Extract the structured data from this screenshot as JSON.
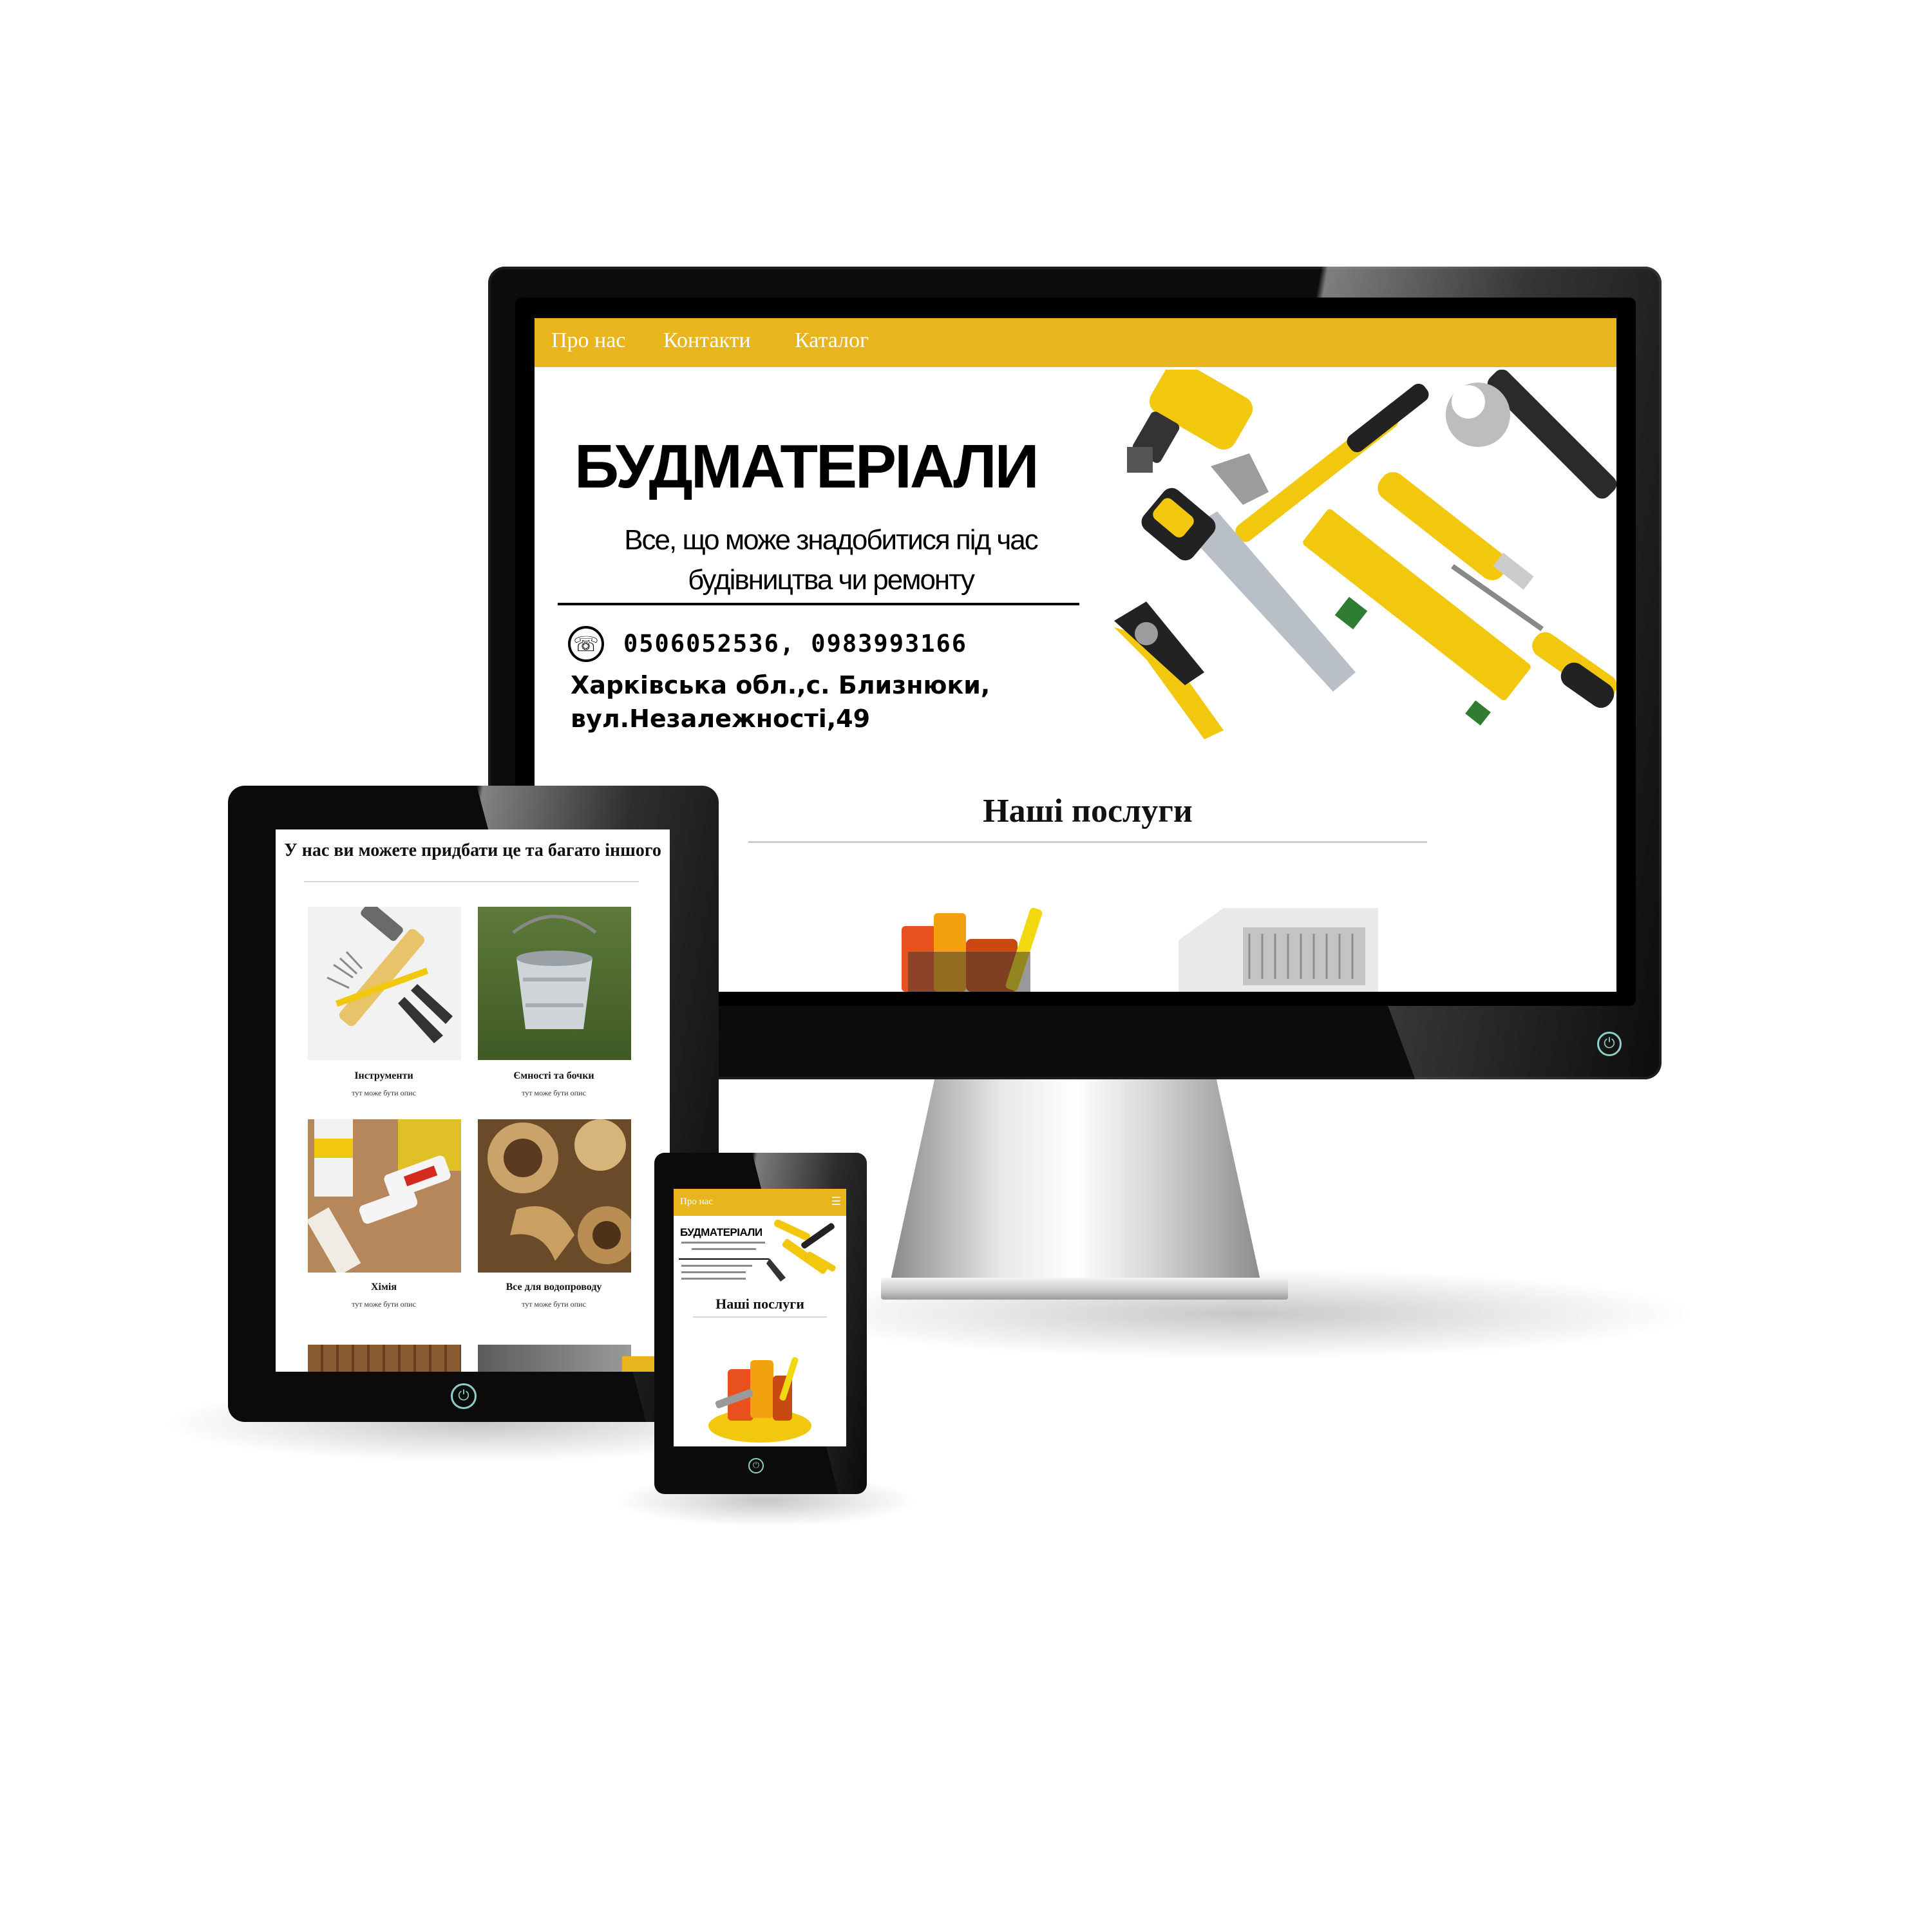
{
  "site": {
    "nav": {
      "about": "Про нас",
      "contacts": "Контакти",
      "catalog": "Каталог"
    },
    "hero": {
      "title": "БУДМАТЕРІАЛИ",
      "tagline_line1": "Все, що може знадобитися під час",
      "tagline_line2": "будівництва чи ремонту",
      "phones": "0506052536, 0983993166",
      "address_line1": "Харківська обл.,с. Близнюки,",
      "address_line2": "вул.Незалежності,49"
    },
    "services_heading": "Наші послуги"
  },
  "tablet": {
    "heading": "У нас ви можете придбати це та багато іншого",
    "products": [
      {
        "title": "Інструменти",
        "desc": "тут може бути опис"
      },
      {
        "title": "Ємності та бочки",
        "desc": "тут може бути опис"
      },
      {
        "title": "Хімія",
        "desc": "тут може бути опис"
      },
      {
        "title": "Все для водопроводу",
        "desc": "тут може бути опис"
      }
    ]
  },
  "phone": {
    "nav_link": "Про нас",
    "menu_icon": "☰",
    "title": "БУДМАТЕРІАЛИ",
    "services_heading": "Наші послуги"
  },
  "colors": {
    "accent": "#e9b51f",
    "device_frame": "#0b0b0b",
    "power_icon": "#8fd0c8"
  },
  "icons": {
    "phone": "☏",
    "power": "⏻",
    "hamburger": "☰"
  }
}
